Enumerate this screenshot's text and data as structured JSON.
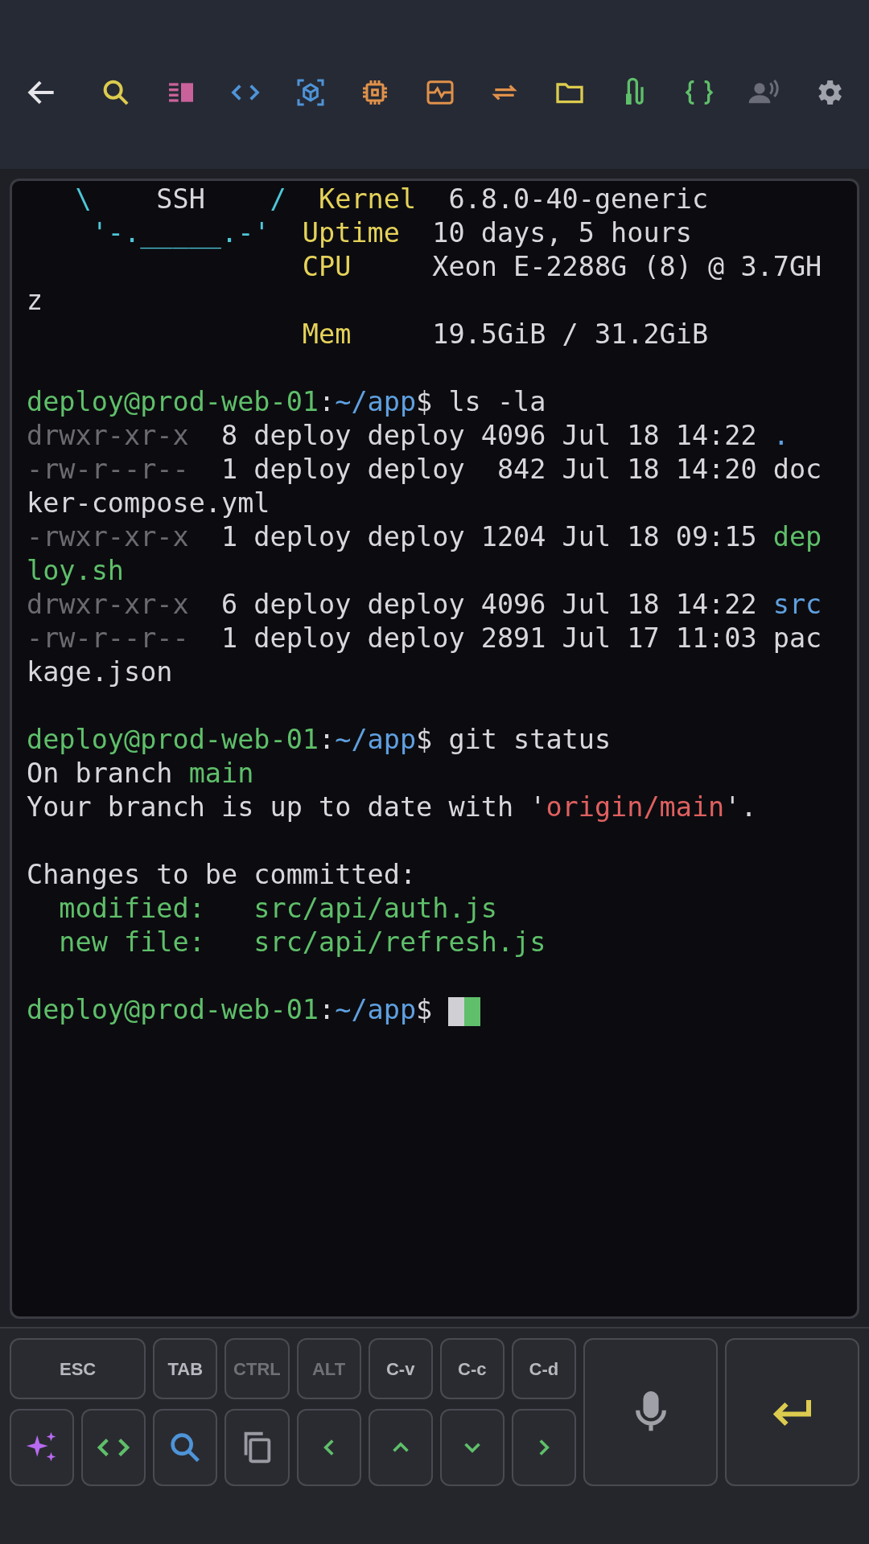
{
  "terminal": {
    "lines": [
      {
        "gap_before": false,
        "segments": [
          {
            "kind": "ascii",
            "text": "   \\"
          },
          {
            "kind": "plain",
            "text": "    SSH"
          },
          {
            "kind": "ascii",
            "text": "    /"
          },
          {
            "kind": "label",
            "text": "  Kernel"
          },
          {
            "kind": "plain",
            "text": "  6.8.0-40-generic"
          }
        ]
      },
      {
        "gap_before": false,
        "segments": [
          {
            "kind": "ascii",
            "text": "    '-._____.-'"
          },
          {
            "kind": "label",
            "text": "  Uptime"
          },
          {
            "kind": "plain",
            "text": "  10 days, 5 hours"
          }
        ]
      },
      {
        "gap_before": false,
        "segments": [
          {
            "kind": "label",
            "text": "                 CPU"
          },
          {
            "kind": "plain",
            "text": "     Xeon E-2288G (8) @ 3.7GH"
          }
        ]
      },
      {
        "gap_before": false,
        "segments": [
          {
            "kind": "plain",
            "text": "z"
          }
        ]
      },
      {
        "gap_before": false,
        "segments": [
          {
            "kind": "label",
            "text": "                 Mem"
          },
          {
            "kind": "plain",
            "text": "     19.5GiB / 31.2GiB"
          }
        ]
      },
      {
        "gap_before": true,
        "segments": [
          {
            "kind": "user",
            "text": "deploy@prod-web-01"
          },
          {
            "kind": "plain",
            "text": ":"
          },
          {
            "kind": "path",
            "text": "~/app"
          },
          {
            "kind": "plain",
            "text": "$ ls -la"
          }
        ]
      },
      {
        "gap_before": false,
        "segments": [
          {
            "kind": "dim",
            "text": "drwxr-xr-x"
          },
          {
            "kind": "plain",
            "text": "  8 deploy deploy 4096 Jul 18 14:22 "
          },
          {
            "kind": "dir",
            "text": "."
          }
        ]
      },
      {
        "gap_before": false,
        "segments": [
          {
            "kind": "dim",
            "text": "-rw-r--r--"
          },
          {
            "kind": "plain",
            "text": "  1 deploy deploy  842 Jul 18 14:20 doc"
          }
        ]
      },
      {
        "gap_before": false,
        "segments": [
          {
            "kind": "plain",
            "text": "ker-compose.yml"
          }
        ]
      },
      {
        "gap_before": false,
        "segments": [
          {
            "kind": "dim",
            "text": "-rwxr-xr-x"
          },
          {
            "kind": "plain",
            "text": "  1 deploy deploy 1204 Jul 18 09:15 "
          },
          {
            "kind": "exec",
            "text": "dep"
          }
        ]
      },
      {
        "gap_before": false,
        "segments": [
          {
            "kind": "exec",
            "text": "loy.sh"
          }
        ]
      },
      {
        "gap_before": false,
        "segments": [
          {
            "kind": "dim",
            "text": "drwxr-xr-x"
          },
          {
            "kind": "plain",
            "text": "  6 deploy deploy 4096 Jul 18 14:22 "
          },
          {
            "kind": "dir",
            "text": "src"
          }
        ]
      },
      {
        "gap_before": false,
        "segments": [
          {
            "kind": "dim",
            "text": "-rw-r--r--"
          },
          {
            "kind": "plain",
            "text": "  1 deploy deploy 2891 Jul 17 11:03 pac"
          }
        ]
      },
      {
        "gap_before": false,
        "segments": [
          {
            "kind": "plain",
            "text": "kage.json"
          }
        ]
      },
      {
        "gap_before": true,
        "segments": [
          {
            "kind": "user",
            "text": "deploy@prod-web-01"
          },
          {
            "kind": "plain",
            "text": ":"
          },
          {
            "kind": "path",
            "text": "~/app"
          },
          {
            "kind": "plain",
            "text": "$ git status"
          }
        ]
      },
      {
        "gap_before": false,
        "segments": [
          {
            "kind": "plain",
            "text": "On branch "
          },
          {
            "kind": "exec",
            "text": "main"
          }
        ]
      },
      {
        "gap_before": false,
        "segments": [
          {
            "kind": "plain",
            "text": "Your branch is up to date with '"
          },
          {
            "kind": "remote",
            "text": "origin/main"
          },
          {
            "kind": "plain",
            "text": "'."
          }
        ]
      },
      {
        "gap_before": true,
        "segments": [
          {
            "kind": "plain",
            "text": "Changes to be committed:"
          }
        ]
      },
      {
        "gap_before": false,
        "segments": [
          {
            "kind": "exec",
            "text": "  modified:   src/api/auth.js"
          }
        ]
      },
      {
        "gap_before": false,
        "segments": [
          {
            "kind": "exec",
            "text": "  new file:   src/api/refresh.js"
          }
        ]
      },
      {
        "gap_before": true,
        "segments": [
          {
            "kind": "user",
            "text": "deploy@prod-web-01"
          },
          {
            "kind": "plain",
            "text": ":"
          },
          {
            "kind": "path",
            "text": "~/app"
          },
          {
            "kind": "plain",
            "text": "$"
          },
          {
            "kind": "cursor"
          }
        ]
      }
    ]
  },
  "keys": [
    {
      "label": "ESC",
      "disabled": false
    },
    {
      "label": "TAB",
      "disabled": false
    },
    {
      "label": "CTRL",
      "disabled": true
    },
    {
      "label": "ALT",
      "disabled": true
    },
    {
      "label": "C-v",
      "disabled": false
    },
    {
      "label": "C-c",
      "disabled": false
    },
    {
      "label": "C-d",
      "disabled": false
    }
  ]
}
